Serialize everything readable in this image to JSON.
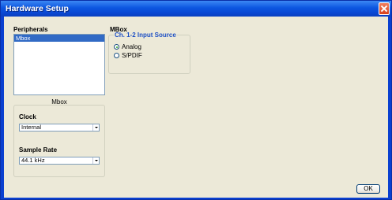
{
  "window": {
    "title": "Hardware Setup"
  },
  "peripherals": {
    "label": "Peripherals",
    "items": [
      "Mbox"
    ],
    "selected": "Mbox",
    "caption": "Mbox"
  },
  "device_panel": {
    "title": "MBox",
    "input_source": {
      "label": "Ch. 1-2 Input Source",
      "options": [
        {
          "label": "Analog",
          "checked": true
        },
        {
          "label": "S/PDIF",
          "checked": false
        }
      ]
    }
  },
  "clock": {
    "label": "Clock",
    "value": "Internal"
  },
  "sample_rate": {
    "label": "Sample Rate",
    "value": "44.1 kHz"
  },
  "buttons": {
    "ok": "OK"
  },
  "colors": {
    "titlebar": "#0a48d4",
    "client": "#ece9d8",
    "group_title": "#1d4fc4",
    "selection": "#316ac5"
  }
}
